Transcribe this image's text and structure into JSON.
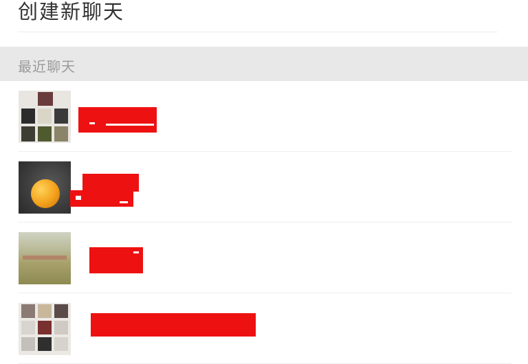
{
  "header": {
    "create_chat_label": "创建新聊天"
  },
  "recent": {
    "section_title": "最近聊天",
    "items": [
      {
        "avatar": "group-avatar-grid",
        "name": ""
      },
      {
        "avatar": "orange-photo-avatar",
        "name": ""
      },
      {
        "avatar": "landscape-photo-avatar",
        "name": ""
      },
      {
        "avatar": "group-avatar-grid",
        "name": ""
      }
    ]
  },
  "colors": {
    "redaction": "#ee1111",
    "section_bg": "#e8e8e8",
    "divider": "#eeeeee"
  }
}
